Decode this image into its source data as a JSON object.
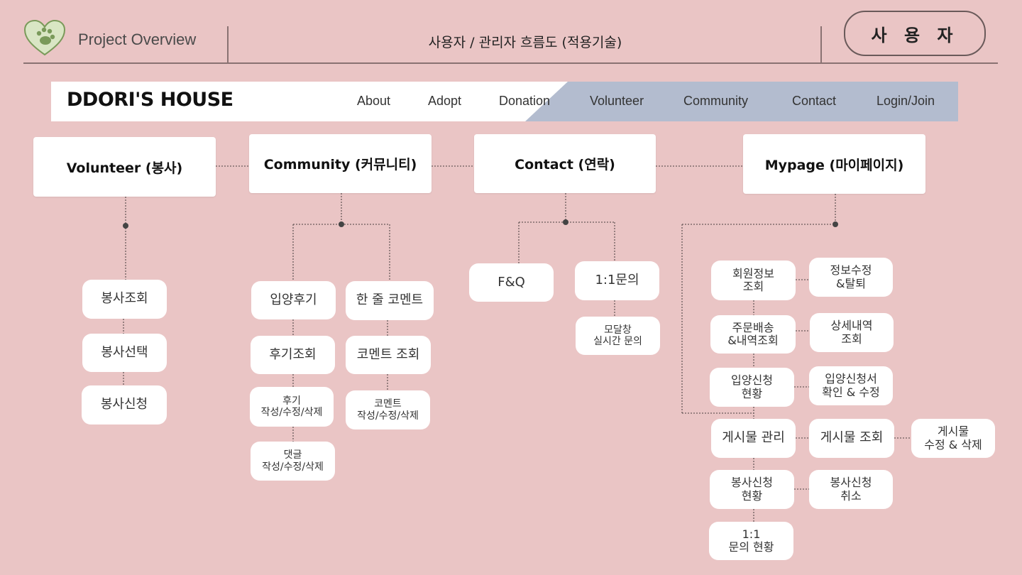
{
  "header": {
    "title": "Project Overview",
    "subtitle": "사용자 / 관리자 흐름도 (적용기술)",
    "role_badge": "사 용 자",
    "logo_icon": "heart-paw-icon"
  },
  "navbar": {
    "brand": "DDORI'S HOUSE",
    "items": [
      "About",
      "Adopt",
      "Donation",
      "Volunteer",
      "Community",
      "Contact",
      "Login/Join"
    ],
    "accent_color": "#b3bccf"
  },
  "sections": {
    "volunteer": {
      "title": "Volunteer (봉사)",
      "items": [
        "봉사조회",
        "봉사선택",
        "봉사신청"
      ]
    },
    "community": {
      "title": "Community (커뮤니티)",
      "review": [
        "입양후기",
        "후기조회",
        "후기\n작성/수정/삭제",
        "댓글\n작성/수정/삭제"
      ],
      "comment": [
        "한 줄 코멘트",
        "코멘트 조회",
        "코멘트\n작성/수정/삭제"
      ]
    },
    "contact": {
      "title": "Contact (연락)",
      "faq": "F&Q",
      "inquiry": "1:1문의",
      "inquiry_detail": "모달창\n실시간 문의"
    },
    "mypage": {
      "title": "Mypage (마이페이지)",
      "rows": [
        {
          "main": "회원정보\n조회",
          "sub": "정보수정\n&탈퇴"
        },
        {
          "main": "주문배송\n&내역조회",
          "sub": "상세내역\n조회"
        },
        {
          "main": "입양신청\n현황",
          "sub": "입양신청서\n확인 & 수정"
        },
        {
          "main": "게시물 관리",
          "sub": "게시물 조회",
          "extra": "게시물\n수정 & 삭제"
        },
        {
          "main": "봉사신청\n현황",
          "sub": "봉사신청\n취소"
        },
        {
          "main": "1:1\n문의 현황"
        }
      ]
    }
  }
}
